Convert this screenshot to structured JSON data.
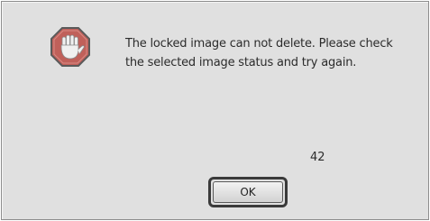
{
  "dialog": {
    "icon": "stop-hand-icon",
    "message": "The locked image can not delete. Please check the selected image status and try again.",
    "code": "42",
    "ok_label": "OK"
  },
  "colors": {
    "dialog_background": "#e0e0e0",
    "icon_fill": "#c0605a",
    "text": "#2b2b2b"
  }
}
